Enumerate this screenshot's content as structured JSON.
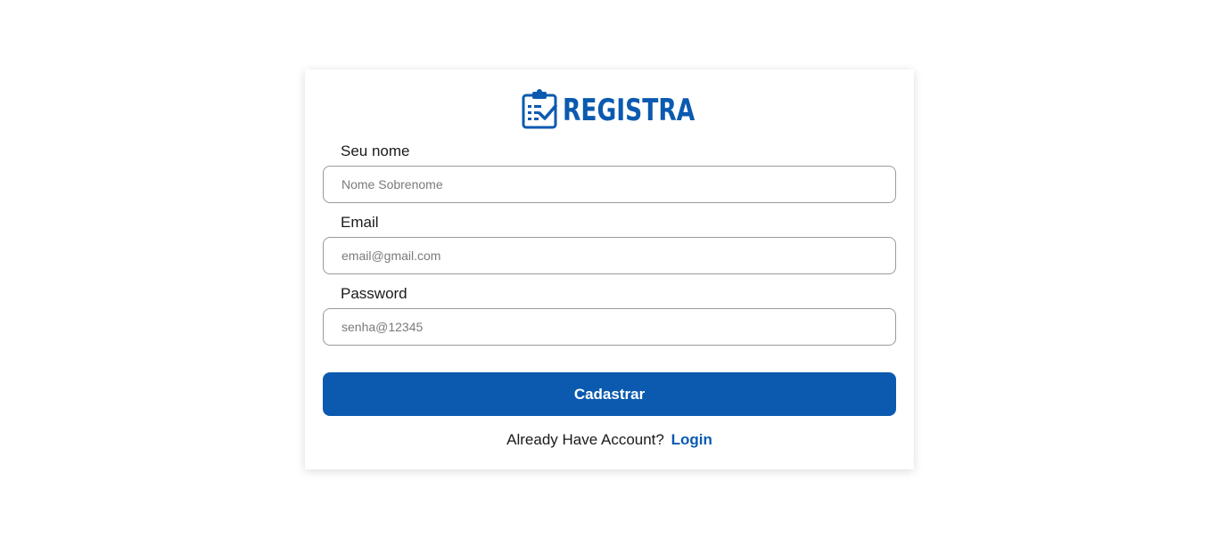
{
  "brand": {
    "name": "REGISTRA",
    "icon": "clipboard-check-icon",
    "color": "#0b5ab0"
  },
  "form": {
    "name_label": "Seu nome",
    "name_placeholder": "Nome Sobrenome",
    "email_label": "Email",
    "email_placeholder": "email@gmail.com",
    "password_label": "Password",
    "password_placeholder": "senha@12345",
    "submit_label": "Cadastrar"
  },
  "footer": {
    "prompt": "Already Have Account?",
    "login_link": "Login"
  }
}
